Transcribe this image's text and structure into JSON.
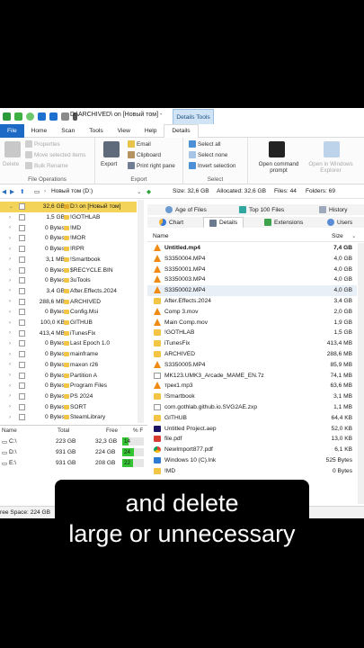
{
  "window": {
    "title": "D:\\ARCHIVED\\  on  [Новый том] - ",
    "context_tab": "Details Tools"
  },
  "ribbon_tabs": [
    "File",
    "Home",
    "Scan",
    "Tools",
    "View",
    "Help",
    "Details"
  ],
  "ribbon": {
    "file_operations": {
      "label": "File Operations",
      "delete": "Delete",
      "properties": "Properties",
      "move_selected": "Move selected items",
      "bulk_rename": "Bulk Rename"
    },
    "export": {
      "label": "Export",
      "export": "Export",
      "email": "Email",
      "clipboard": "Clipboard",
      "print_right_pane": "Print right pane"
    },
    "select": {
      "label": "Select",
      "select_all": "Select all",
      "select_none": "Select none",
      "invert_selection": "Invert selection"
    },
    "open": {
      "open_command_prompt": "Open command prompt",
      "open_in_explorer": "Open in Windows Explorer"
    }
  },
  "address": {
    "drive": "Новый том (D:)"
  },
  "info": {
    "size": "Size: 32,6 GB",
    "allocated": "Allocated: 32,6 GB",
    "files": "Files: 44",
    "folders": "Folders: 69"
  },
  "view_tabs_row1": [
    "Age of Files",
    "Top 100 Files",
    "History"
  ],
  "view_tabs_row2": [
    "Chart",
    "Details",
    "Extensions",
    "Users"
  ],
  "columns": {
    "name": "Name",
    "size": "Size"
  },
  "tree": {
    "root": {
      "size": "32,6 GB",
      "name": "D:\\  on  [Новый том]"
    },
    "items": [
      {
        "size": "1,5 GB",
        "name": "!GOTHLAB"
      },
      {
        "size": "0 Bytes",
        "name": "!MD"
      },
      {
        "size": "0 Bytes",
        "name": "!MOR"
      },
      {
        "size": "0 Bytes",
        "name": "!RPR"
      },
      {
        "size": "3,1 MB",
        "name": "!Smartbook"
      },
      {
        "size": "0 Bytes",
        "name": "$RECYCLE.BIN"
      },
      {
        "size": "0 Bytes",
        "name": "3uTools"
      },
      {
        "size": "3,4 GB",
        "name": "After.Effects.2024"
      },
      {
        "size": "288,6 MB",
        "name": "ARCHIVED"
      },
      {
        "size": "0 Bytes",
        "name": "Config.Msi"
      },
      {
        "size": "100,0 KB",
        "name": "GITHUB"
      },
      {
        "size": "413,4 MB",
        "name": "iTunesFix"
      },
      {
        "size": "0 Bytes",
        "name": "Last Epoch 1.0"
      },
      {
        "size": "0 Bytes",
        "name": "mainframe"
      },
      {
        "size": "0 Bytes",
        "name": "maxon r26"
      },
      {
        "size": "0 Bytes",
        "name": "Partition A"
      },
      {
        "size": "0 Bytes",
        "name": "Program Files"
      },
      {
        "size": "0 Bytes",
        "name": "PS 2024"
      },
      {
        "size": "0 Bytes",
        "name": "SORT"
      },
      {
        "size": "0 Bytes",
        "name": "SteamLibrary"
      }
    ]
  },
  "drives": {
    "headers": {
      "name": "Name",
      "total": "Total",
      "free": "Free",
      "pct": "% F"
    },
    "rows": [
      {
        "name": "C:\\",
        "total": "223 GB",
        "free": "32,3 GB",
        "pct": "14",
        "pct_value": 14
      },
      {
        "name": "D:\\",
        "total": "931 GB",
        "free": "224 GB",
        "pct": "24",
        "pct_value": 24
      },
      {
        "name": "E:\\",
        "total": "931 GB",
        "free": "208 GB",
        "pct": "22",
        "pct_value": 22
      }
    ]
  },
  "status": {
    "free_space": "ree Space: 224 GB"
  },
  "files": [
    {
      "name": "Untitled.mp4",
      "size": "7,4 GB",
      "icon": "vlc",
      "bold": true
    },
    {
      "name": "S3350004.MP4",
      "size": "4,0 GB",
      "icon": "vlc"
    },
    {
      "name": "S3350001.MP4",
      "size": "4,0 GB",
      "icon": "vlc"
    },
    {
      "name": "S3350003.MP4",
      "size": "4,0 GB",
      "icon": "vlc"
    },
    {
      "name": "S3350002.MP4",
      "size": "4,0 GB",
      "icon": "vlc"
    },
    {
      "name": "After.Effects.2024",
      "size": "3,4 GB",
      "icon": "folder"
    },
    {
      "name": "Comp 3.mov",
      "size": "2,0 GB",
      "icon": "vlc"
    },
    {
      "name": "Main Comp.mov",
      "size": "1,9 GB",
      "icon": "vlc"
    },
    {
      "name": "!GOTHLAB",
      "size": "1,5 GB",
      "icon": "folder"
    },
    {
      "name": "iTunesFix",
      "size": "413,4 MB",
      "icon": "folder"
    },
    {
      "name": "ARCHIVED",
      "size": "288,6 MB",
      "icon": "folder"
    },
    {
      "name": "S3350005.MP4",
      "size": "85,9 MB",
      "icon": "vlc"
    },
    {
      "name": "MK123.UMK3_Arcade_MAME_EN.7z",
      "size": "74,1 MB",
      "icon": "doc"
    },
    {
      "name": "трек1.mp3",
      "size": "63,6 MB",
      "icon": "vlc"
    },
    {
      "name": "!Smartbook",
      "size": "3,1 MB",
      "icon": "folder"
    },
    {
      "name": "com.gothlab.github.io.SVG2AE.zxp",
      "size": "1,1 MB",
      "icon": "doc"
    },
    {
      "name": "GITHUB",
      "size": "64,4 KB",
      "icon": "folder"
    },
    {
      "name": "Untitled Project.aep",
      "size": "52,0 KB",
      "icon": "ae"
    },
    {
      "name": "file.pdf",
      "size": "13,0 KB",
      "icon": "pdf"
    },
    {
      "name": "NewImport877.pdf",
      "size": "6,1 KB",
      "icon": "chrome"
    },
    {
      "name": "Windows 10 (C).lnk",
      "size": "525 Bytes",
      "icon": "winlnk"
    },
    {
      "name": "!MD",
      "size": "0 Bytes",
      "icon": "folder"
    }
  ],
  "caption": {
    "line1": "and delete",
    "line2": "large or unnecessary"
  },
  "colors": {
    "file_tab": "#1c6ac6",
    "tree_selected": "#f4d458",
    "folder": "#f3c545",
    "vlc": "#f08a12",
    "pct_bar": "#33c333"
  }
}
